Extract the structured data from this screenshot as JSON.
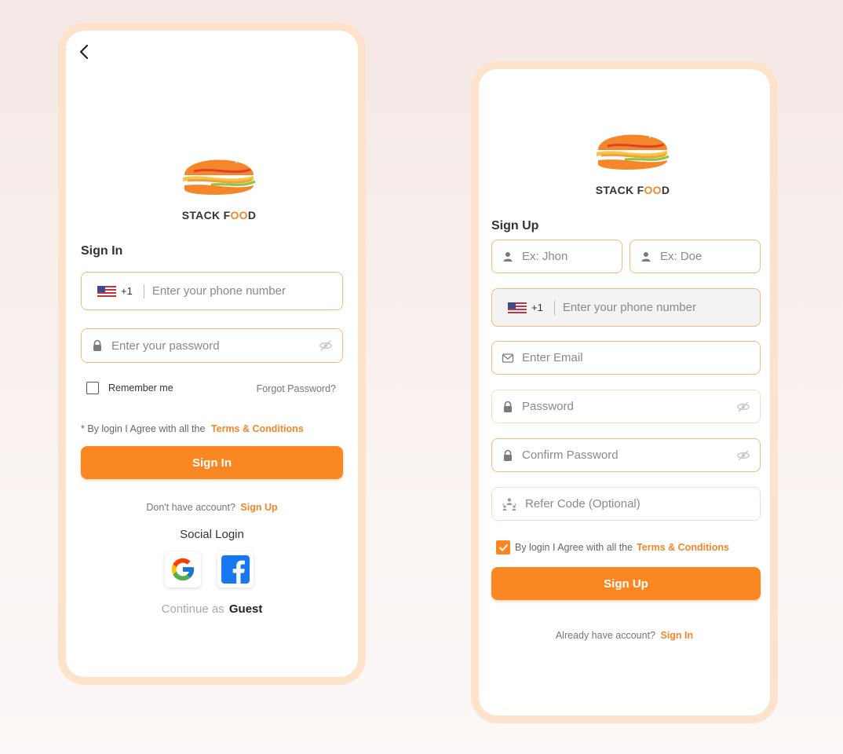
{
  "colors": {
    "accent": "#FB8722",
    "frame": "#FDE3CC",
    "field_border": "#F3BD7B"
  },
  "brand": {
    "name_left": "STACK F",
    "name_oo": "OO",
    "name_right": "D"
  },
  "signin": {
    "back_icon": "chevron-left-icon",
    "heading": "Sign In",
    "country_code": "+1",
    "phone_placeholder": "Enter your phone number",
    "password_placeholder": "Enter your password",
    "remember_me": "Remember me",
    "forgot_password": "Forgot Password?",
    "agree_prefix": "* By login I Agree with all the",
    "terms": "Terms & Conditions",
    "button": "Sign In",
    "no_account": "Don't have account?",
    "signup_link": "Sign Up",
    "social_heading": "Social Login",
    "continue_as": "Continue as",
    "guest": "Guest"
  },
  "signup": {
    "heading": "Sign Up",
    "first_name_placeholder": "Ex: Jhon",
    "last_name_placeholder": "Ex: Doe",
    "country_code": "+1",
    "phone_placeholder": "Enter your phone number",
    "email_placeholder": "Enter Email",
    "password_placeholder": "Password",
    "confirm_password_placeholder": "Confirm Password",
    "refer_placeholder": "Refer Code (Optional)",
    "agree_prefix": "By login I Agree with all the",
    "terms": "Terms & Conditions",
    "terms_checked": true,
    "button": "Sign Up",
    "have_account": "Already have account?",
    "signin_link": "Sign In"
  }
}
